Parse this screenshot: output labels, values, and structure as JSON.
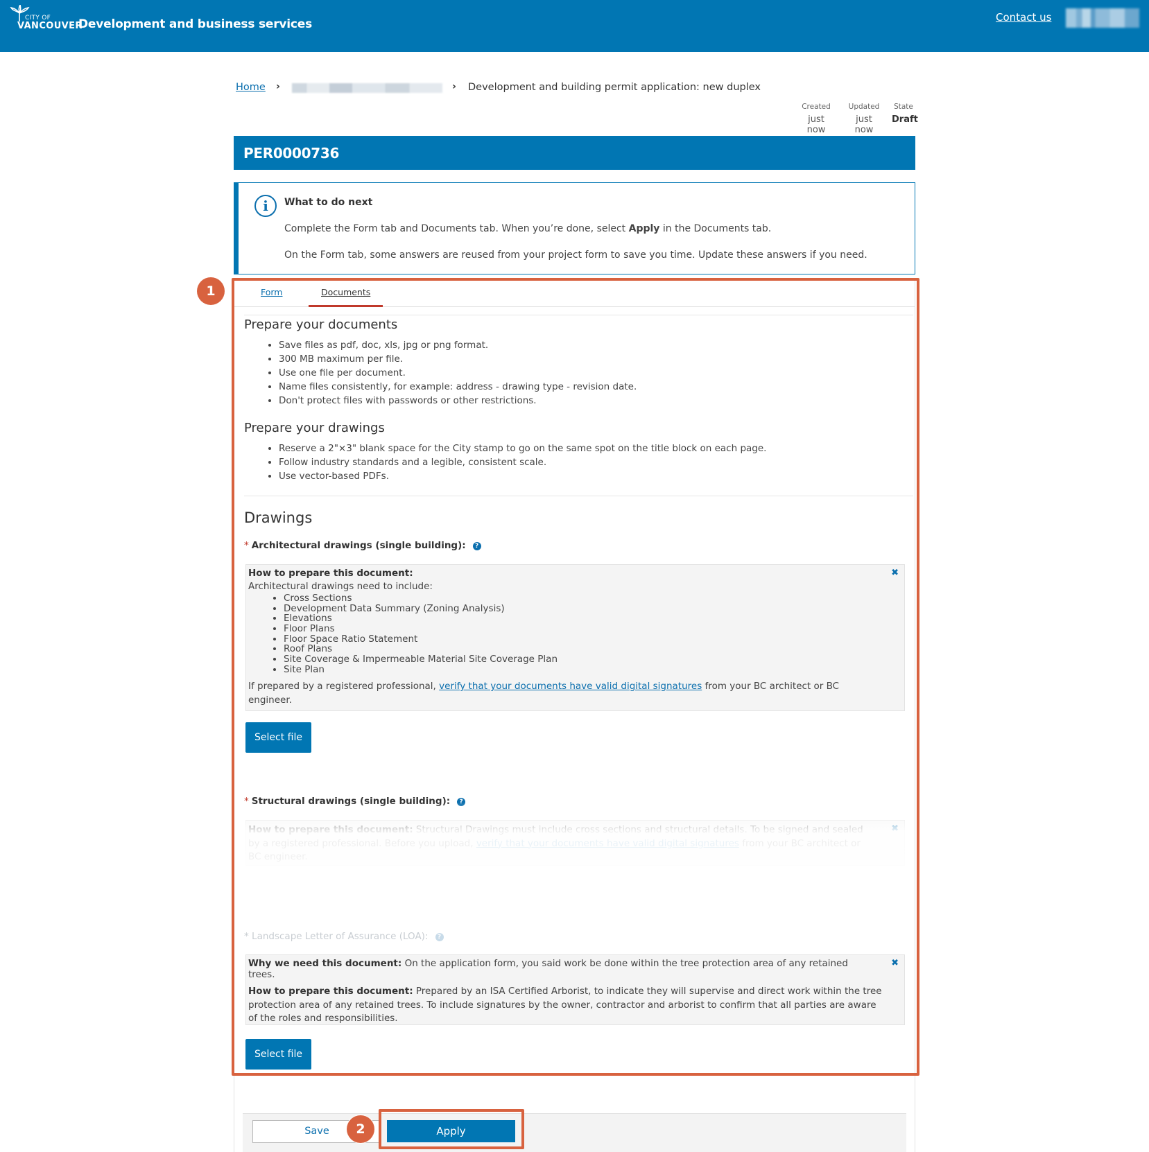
{
  "header": {
    "logo_city_of": "CITY OF",
    "logo_vancouver": "VANCOUVER",
    "app_title": "Development and business services",
    "contact_link": "Contact us"
  },
  "breadcrumb": {
    "home": "Home",
    "current": "Development and building permit application: new duplex"
  },
  "meta": {
    "created_label": "Created",
    "created_value": "just now",
    "updated_label": "Updated",
    "updated_value": "just now",
    "state_label": "State",
    "state_value": "Draft"
  },
  "record": {
    "number": "PER0000736"
  },
  "info": {
    "heading": "What to do next",
    "line1_before": "Complete the Form tab and Documents tab. When you’re done, select ",
    "line1_bold": "Apply",
    "line1_after": " in the Documents tab.",
    "line2": "On the Form tab, some answers are reused from your project form to save you time. Update these answers if you need."
  },
  "tabs": {
    "form": "Form",
    "documents": "Documents"
  },
  "prepare_documents": {
    "title": "Prepare your documents",
    "items": [
      "Save files as pdf, doc, xls, jpg or png format.",
      "300 MB maximum per file.",
      "Use one file per document.",
      "Name files consistently, for example: address - drawing type - revision date.",
      "Don't protect files with passwords or other restrictions."
    ]
  },
  "prepare_drawings": {
    "title": "Prepare your drawings",
    "items": [
      "Reserve a 2\"×3\" blank space for the City stamp to go on the same spot on the title block on each page.",
      "Follow industry standards and a legible, consistent scale.",
      "Use vector-based PDFs."
    ]
  },
  "drawings": {
    "heading": "Drawings",
    "architectural": {
      "label": "Architectural drawings (single building):",
      "guide_title": "How to prepare this document:",
      "guide_intro": "Architectural drawings need to include:",
      "items": [
        "Cross Sections",
        "Development Data Summary (Zoning Analysis)",
        "Elevations",
        "Floor Plans",
        "Floor Space Ratio Statement",
        "Roof Plans",
        "Site Coverage & Impermeable Material Site Coverage Plan",
        "Site Plan"
      ],
      "footer_before": "If prepared by a registered professional, ",
      "footer_link": "verify that your documents have valid digital signatures",
      "footer_after": " from your BC architect or BC engineer.",
      "button": "Select file"
    },
    "structural": {
      "label": "Structural drawings (single building):",
      "guide_title": "How to prepare this document:",
      "guide_text": " Structural Drawings must include cross sections and structural details. To be signed and sealed by a registered professional. Before you upload, ",
      "guide_link": "verify that your documents have valid digital signatures",
      "guide_after": " from your BC architect or BC engineer."
    },
    "landscape": {
      "label": "Landscape Letter of Assurance (LOA):",
      "why_title": "Why we need this document:",
      "why_text": " On the application form, you said work be done within the tree protection area of any retained trees.",
      "how_title": "How to prepare this document:",
      "how_text": " Prepared by an ISA Certified Arborist, to indicate they will supervise and direct work within the tree protection area of any retained trees. To include signatures by the owner, contractor and arborist to confirm that all parties are aware of the roles and responsibilities.",
      "button": "Select file"
    }
  },
  "actions": {
    "save": "Save",
    "apply": "Apply"
  },
  "callouts": {
    "one": "1",
    "two": "2"
  },
  "colors": {
    "brand": "#0176b3",
    "annotation": "#d8623f",
    "required": "#c0392b"
  }
}
